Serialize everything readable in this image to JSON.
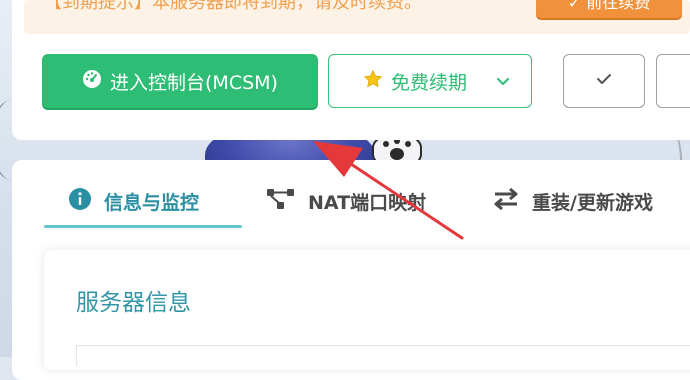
{
  "notice": {
    "text": "【到期提示】本服务器即将到期，请及时续费。",
    "button_label": "✓ 前往续费"
  },
  "actions": {
    "console_label": "进入控制台(MCSM)",
    "renew_label": "免费续期"
  },
  "tabs": [
    {
      "label": "信息与监控",
      "icon": "info-circle-icon",
      "active": true
    },
    {
      "label": "NAT端口映射",
      "icon": "network-nodes-icon",
      "active": false
    },
    {
      "label": "重装/更新游戏",
      "icon": "swap-arrows-icon",
      "active": false
    }
  ],
  "panel": {
    "title": "服务器信息"
  },
  "colors": {
    "primary_green": "#2dbd74",
    "accent_teal": "#2b8fa3",
    "warning_orange": "#f2913b",
    "annotation_red": "#e5383b"
  }
}
